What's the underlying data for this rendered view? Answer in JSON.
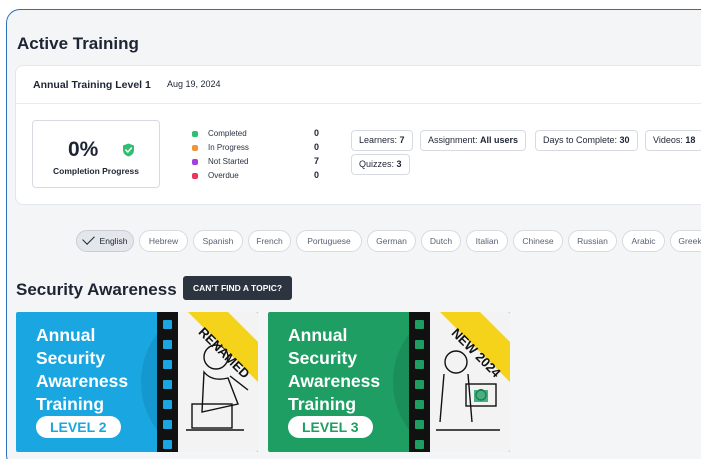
{
  "active_training": {
    "title": "Active Training",
    "level_name": "Annual Training Level 1",
    "date": "Aug 19, 2024",
    "progress": {
      "percent": "0%",
      "label": "Completion Progress"
    },
    "legend": [
      {
        "label": "Completed",
        "value": "0",
        "color": "#2fbf71"
      },
      {
        "label": "In Progress",
        "value": "0",
        "color": "#f3943a"
      },
      {
        "label": "Not Started",
        "value": "7",
        "color": "#a63de0"
      },
      {
        "label": "Overdue",
        "value": "0",
        "color": "#e8375e"
      }
    ],
    "stats": [
      {
        "label": "Learners: ",
        "value": "7"
      },
      {
        "label": "Assignment: ",
        "value": "All users"
      },
      {
        "label": "Days to Complete: ",
        "value": "30"
      },
      {
        "label": "Videos: ",
        "value": "18"
      },
      {
        "label": "Quizzes: ",
        "value": "3"
      }
    ]
  },
  "languages": {
    "selected": "English",
    "items": [
      "English",
      "Hebrew",
      "Spanish",
      "French",
      "Portuguese",
      "German",
      "Dutch",
      "Italian",
      "Chinese",
      "Russian",
      "Arabic",
      "Greek"
    ]
  },
  "section": {
    "title": "Security Awareness",
    "cant_find_button": "CAN'T FIND A TOPIC?"
  },
  "courses": [
    {
      "title_lines": [
        "Annual",
        "Security",
        "Awareness",
        "Training"
      ],
      "level": "LEVEL 2",
      "ribbon": "RENAMED",
      "bg": "#1aa6e0",
      "level_color": "#1aa6e0"
    },
    {
      "title_lines": [
        "Annual",
        "Security",
        "Awareness",
        "Training"
      ],
      "level": "LEVEL 3",
      "ribbon": "NEW 2024",
      "bg": "#1f9e63",
      "level_color": "#1f9e63"
    }
  ],
  "colors": {
    "accent_shield": "#2fbf71",
    "ribbon": "#f5d31a",
    "dark_button": "#2c3440",
    "frame_border": "#2d6fb7"
  }
}
